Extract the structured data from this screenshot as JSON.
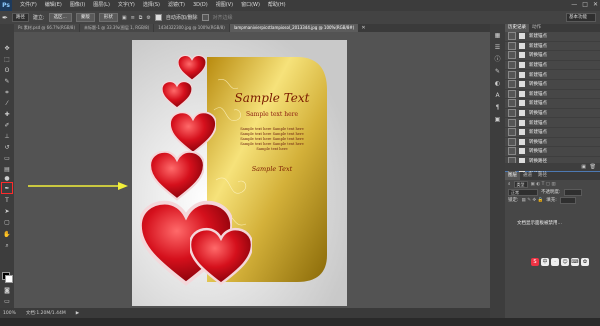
{
  "app": {
    "logo": "Ps"
  },
  "menu": [
    "文件(F)",
    "编辑(E)",
    "图像(I)",
    "图层(L)",
    "文字(Y)",
    "选择(S)",
    "滤镜(T)",
    "3D(D)",
    "视图(V)",
    "窗口(W)",
    "帮助(H)"
  ],
  "window_buttons": [
    "—",
    "□",
    "✕"
  ],
  "options": {
    "tool_dropdown": "路径",
    "make_label": "建立:",
    "selection_btn": "选区...",
    "mask_btn": "蒙版",
    "shape_btn": "形状",
    "auto_add_label": "自动添加/删除",
    "align_edges_label": "对齐边缘",
    "workspace": "基本功能"
  },
  "tabs": [
    {
      "label": "Ps 素材.psd @ 66.7%(RGB/8)",
      "active": false
    },
    {
      "label": "未标题-1 @ 33.3%(图层 1, RGB/8)",
      "active": false
    },
    {
      "label": "1434322300.jpg @ 100%(RGB/8)",
      "active": false
    },
    {
      "label": "lampmanivierpicstlampiosol_2013344.jpg @ 100%(RGB/8#)",
      "active": true
    }
  ],
  "artwork": {
    "title": "Sample Text",
    "subtitle": "Sample text here",
    "body_lines": [
      "Sample text here Sample text here",
      "Sample text here Sample text here",
      "Sample text here Sample text here",
      "Sample text here Sample text here",
      "Sample text here"
    ],
    "bottom_sig": "Sample Text"
  },
  "status": {
    "zoom": "100%",
    "doc": "文档:1.20M/1.44M"
  },
  "history": {
    "tabs": [
      "历史记录",
      "动作"
    ],
    "items": [
      "新建锚点",
      "新建锚点",
      "转换锚点",
      "新建锚点",
      "新建锚点",
      "转换锚点",
      "新建锚点",
      "新建锚点",
      "转换锚点",
      "新建锚点",
      "新建锚点",
      "转换锚点",
      "转换锚点",
      "转换路径",
      "转换路径"
    ],
    "selected_index": 14
  },
  "layers": {
    "tabs": [
      "图层",
      "通道",
      "路径"
    ],
    "kind_label": "类型",
    "mode": "正常",
    "opacity_label": "不透明度:",
    "lock_label": "锁定:",
    "fill_label": "填充:",
    "message": "文档显示面板被禁用…",
    "ime_icons": [
      "S",
      "中",
      "·",
      "☺",
      "⌨",
      "✿"
    ]
  },
  "colors": {
    "accent": "#4d79b2",
    "highlight": "#ff2a2a",
    "arrow": "#f2ef3a"
  }
}
